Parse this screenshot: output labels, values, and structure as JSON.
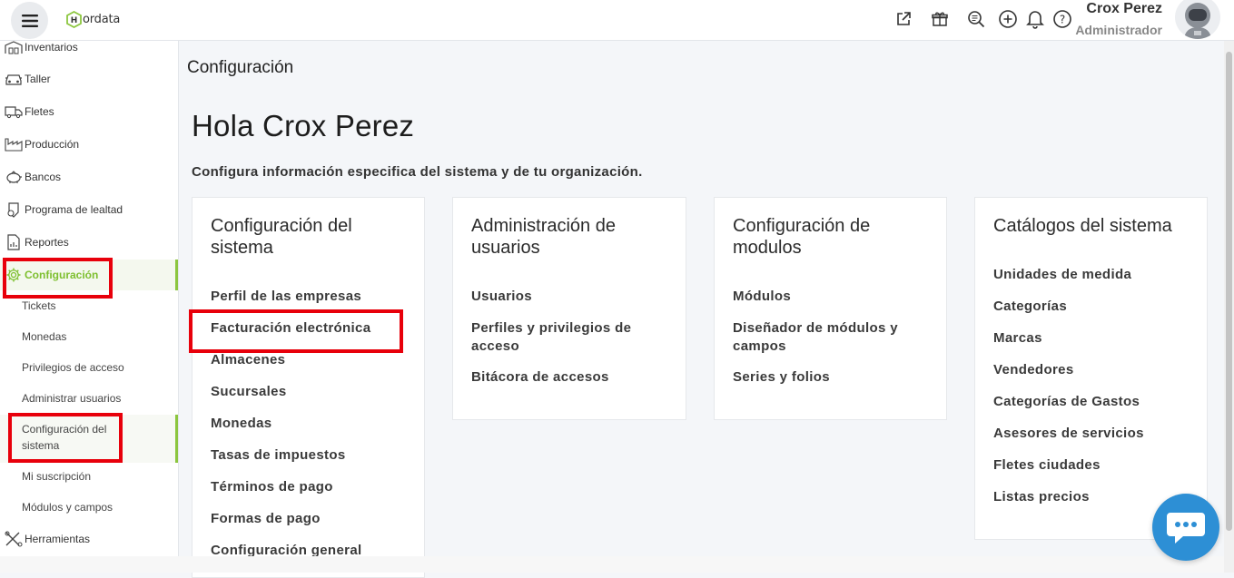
{
  "header": {
    "logo_text": "ordata",
    "logo_letter": "H",
    "user_name": "Crox Perez",
    "user_role": "Administrador",
    "icons": [
      "external-link-icon",
      "gift-icon",
      "search-list-icon",
      "plus-circle-icon",
      "bell-icon",
      "help-icon"
    ]
  },
  "sidebar": {
    "items": [
      {
        "label": "Inventarios",
        "icon": "warehouse-icon"
      },
      {
        "label": "Taller",
        "icon": "car-icon"
      },
      {
        "label": "Fletes",
        "icon": "truck-icon"
      },
      {
        "label": "Producción",
        "icon": "factory-icon"
      },
      {
        "label": "Bancos",
        "icon": "piggy-bank-icon"
      },
      {
        "label": "Programa de lealtad",
        "icon": "loyalty-icon"
      },
      {
        "label": "Reportes",
        "icon": "report-icon"
      },
      {
        "label": "Configuración",
        "icon": "gear-icon"
      }
    ],
    "sub_items": [
      "Tickets",
      "Monedas",
      "Privilegios de acceso",
      "Administrar usuarios",
      "Configuración del sistema",
      "Mi suscripción",
      "Módulos y campos"
    ],
    "tools": {
      "label": "Herramientas",
      "icon": "tools-icon"
    }
  },
  "main": {
    "page_title": "Configuración",
    "greeting": "Hola Crox Perez",
    "subtitle": "Configura información especifica del sistema y de tu organización.",
    "cards": [
      {
        "title": "Configuración del sistema",
        "links": [
          "Perfil de las empresas",
          "Facturación electrónica",
          "Almacenes",
          "Sucursales",
          "Monedas",
          "Tasas de impuestos",
          "Términos de pago",
          "Formas de pago",
          "Configuración general"
        ]
      },
      {
        "title": "Administración de usuarios",
        "links": [
          "Usuarios",
          "Perfiles y privilegios de acceso",
          "Bitácora de accesos"
        ]
      },
      {
        "title": "Configuración de modulos",
        "links": [
          "Módulos",
          "Diseñador de módulos y campos",
          "Series y folios"
        ]
      },
      {
        "title": "Catálogos del sistema",
        "links": [
          "Unidades de medida",
          "Categorías",
          "Marcas",
          "Vendedores",
          "Categorías de Gastos",
          "Asesores de servicios",
          "Fletes ciudades",
          "Listas precios"
        ]
      }
    ]
  },
  "colors": {
    "accent_green": "#8cc63f",
    "highlight_red": "#e8000b",
    "chat_blue": "#2d8fd5"
  }
}
